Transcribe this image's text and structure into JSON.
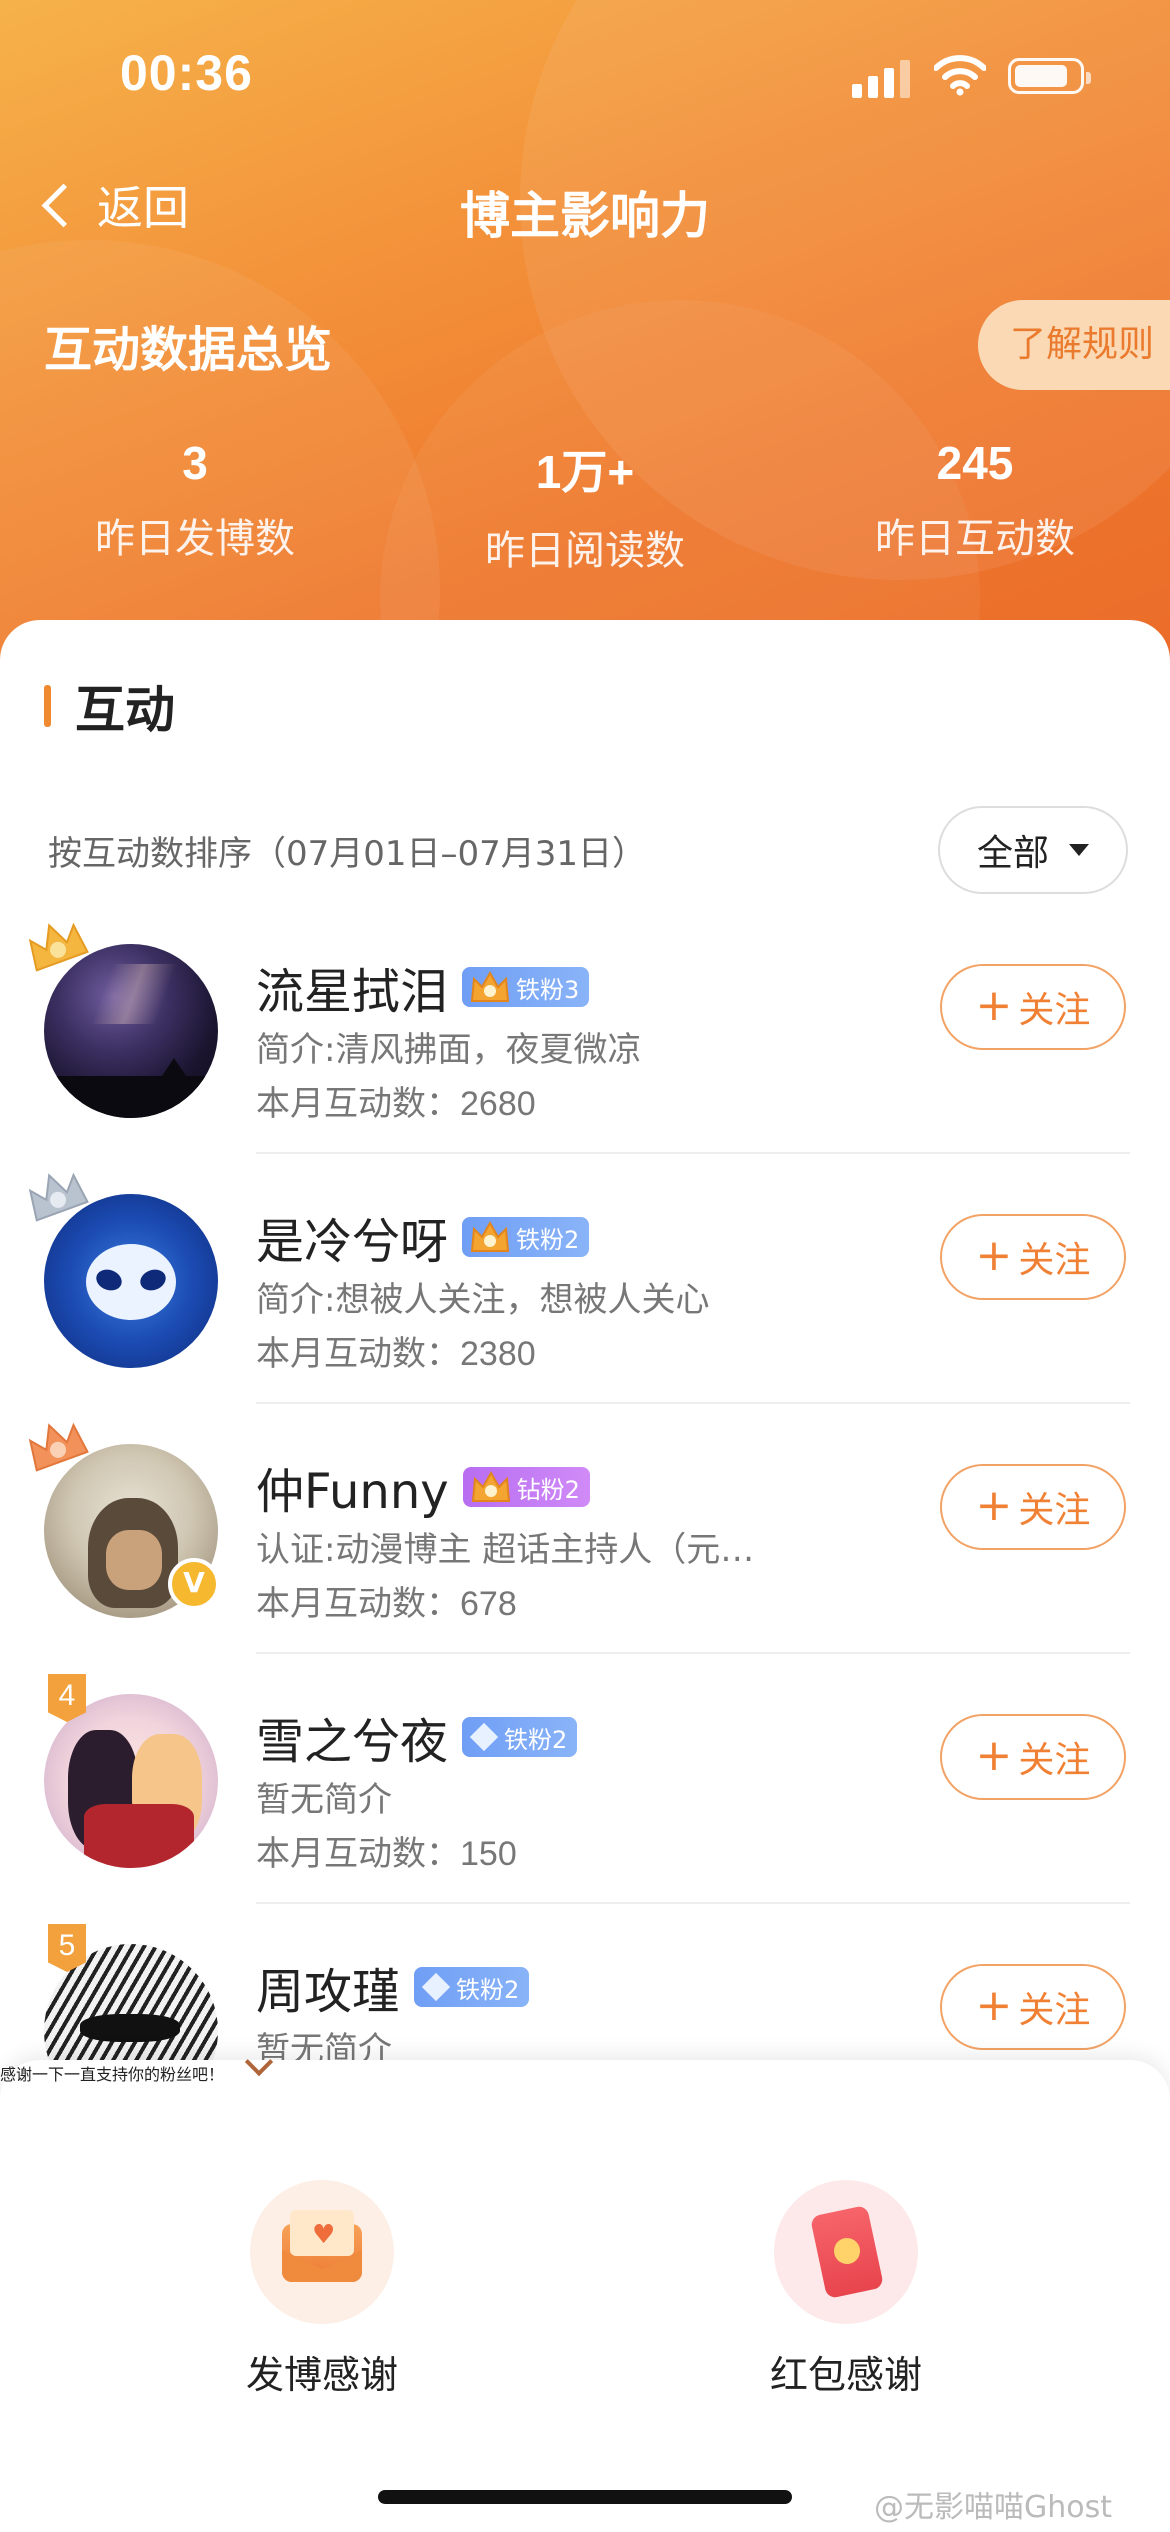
{
  "status": {
    "time": "00:36"
  },
  "nav": {
    "back_label": "返回",
    "title": "博主影响力"
  },
  "overview": {
    "title": "互动数据总览",
    "rules_button": "了解规则",
    "stats": [
      {
        "value": "3",
        "label": "昨日发博数"
      },
      {
        "value": "1万+",
        "label": "昨日阅读数"
      },
      {
        "value": "245",
        "label": "昨日互动数"
      }
    ]
  },
  "section": {
    "title": "互动",
    "sort_text": "按互动数排序（07月01日–07月31日）",
    "filter_label": "全部"
  },
  "fans": [
    {
      "rank": "1",
      "name": "流星拭泪",
      "badge": "铁粉3",
      "badge_color": "blue",
      "desc": "简介:清风拂面，夜夏微凉",
      "count_label": "本月互动数：",
      "count": "2680",
      "follow": "关注"
    },
    {
      "rank": "2",
      "name": "是冷兮呀",
      "badge": "铁粉2",
      "badge_color": "blue",
      "desc": "简介:想被人关注，想被人关心",
      "count_label": "本月互动数：",
      "count": "2380",
      "follow": "关注"
    },
    {
      "rank": "3",
      "name": "仲Funny",
      "badge": "钻粉2",
      "badge_color": "purple",
      "desc": "认证:动漫博主 超话主持人（元…",
      "count_label": "本月互动数：",
      "count": "678",
      "follow": "关注"
    },
    {
      "rank": "4",
      "name": "雪之兮夜",
      "badge": "铁粉2",
      "badge_color": "blue",
      "desc": "暂无简介",
      "count_label": "本月互动数：",
      "count": "150",
      "follow": "关注"
    },
    {
      "rank": "5",
      "name": "周攻瑾",
      "badge": "铁粉2",
      "badge_color": "blue",
      "desc": "暂无简介",
      "count_label": "",
      "count": "",
      "follow": "关注"
    }
  ],
  "sheet": {
    "thanks_text": "感谢一下一直支持你的粉丝吧！",
    "actions": [
      {
        "label": "发博感谢",
        "icon": "envelope-heart-icon"
      },
      {
        "label": "红包感谢",
        "icon": "red-packet-icon"
      }
    ]
  },
  "watermark": "@无影喵喵Ghost",
  "colors": {
    "accent": "#f08034",
    "hero_start": "#f6b24a",
    "hero_end": "#ea6a28"
  }
}
